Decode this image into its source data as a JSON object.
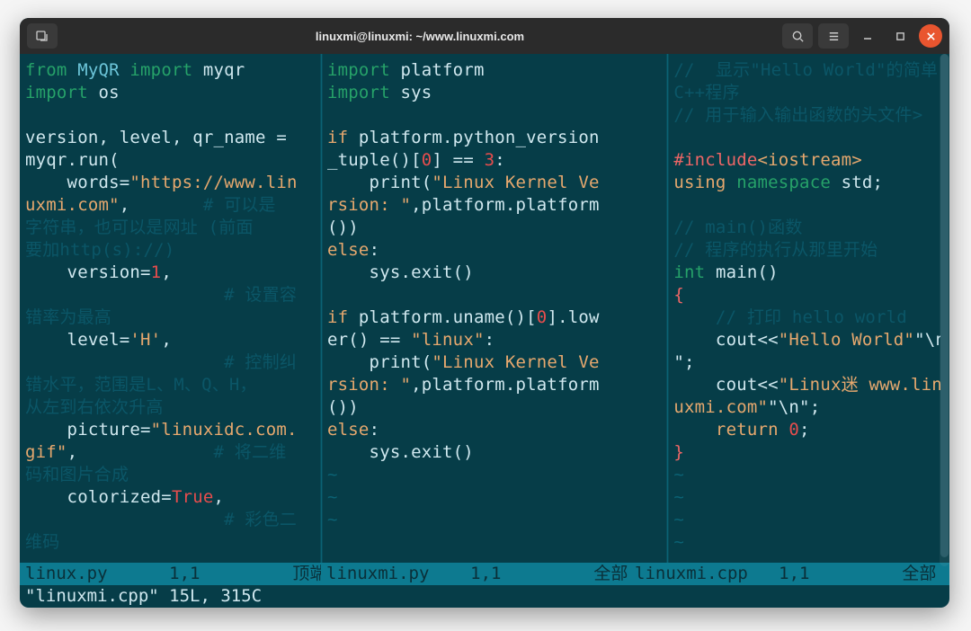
{
  "titlebar": {
    "title": "linuxmi@linuxmi: ~/www.linuxmi.com"
  },
  "cmdline": "\"linuxmi.cpp\" 15L, 315C",
  "status": {
    "p1": "linux.py      1,1         顶端",
    "p2": "linuxmi.py    1,1         全部",
    "p3": "linuxmi.cpp   1,1         全部"
  },
  "pane1": {
    "l01_from": "from",
    "l01_mod": "MyQR",
    "l01_import": "import",
    "l01_name": "myqr",
    "l02_import": "import",
    "l02_name": "os",
    "l04": "version, level, qr_name =",
    "l05": "myqr.run(",
    "l06_key": "    words=",
    "l06_str": "\"https://www.lin",
    "l07_str": "uxmi.com\"",
    "l07_comma": ",",
    "l07_cmt": "       # 可以是",
    "l08_cmt": "字符串，也可以是网址 (前面",
    "l09_cmt": "要加http(s)://)",
    "l10_key": "    version=",
    "l10_num": "1",
    "l10_comma": ",",
    "l11_cmt": "                   # 设置容",
    "l12_cmt": "错率为最高",
    "l13_key": "    level=",
    "l13_str": "'H'",
    "l13_comma": ",",
    "l14_cmt": "                   # 控制纠",
    "l15_cmt": "错水平，范围是L、M、Q、H，",
    "l16_cmt": "从左到右依次升高",
    "l17_key": "    picture=",
    "l17_str": "\"linuxidc.com.",
    "l18_str": "gif\"",
    "l18_comma": ",",
    "l18_cmt": "             # 将二维",
    "l19_cmt": "码和图片合成",
    "l20_key": "    colorized=",
    "l20_const": "True",
    "l20_comma": ",",
    "l21_cmt": "                   # 彩色二",
    "l22_cmt": "维码"
  },
  "pane2": {
    "l01_import": "import",
    "l01_name": "platform",
    "l02_import": "import",
    "l02_name": "sys",
    "l04_if": "if",
    "l04_rest": " platform.python_version",
    "l05a": "_tuple()[",
    "l05_num": "0",
    "l05b": "] == ",
    "l05_three": "3",
    "l05c": ":",
    "l06_print": "    print(",
    "l06_str": "\"Linux Kernel Ve",
    "l07_str": "rsion: \"",
    "l07_rest": ",platform.platform",
    "l08": "())",
    "l09_else": "else",
    "l09_colon": ":",
    "l10": "    sys.exit()",
    "l12_if": "if",
    "l12_rest": " platform.uname()[",
    "l12_num": "0",
    "l12_rest2": "].low",
    "l13a": "er() == ",
    "l13_str": "\"linux\"",
    "l13b": ":",
    "l14_print": "    print(",
    "l14_str": "\"Linux Kernel Ve",
    "l15_str": "rsion: \"",
    "l15_rest": ",platform.platform",
    "l16": "())",
    "l17_else": "else",
    "l17_colon": ":",
    "l18": "    sys.exit()",
    "tilde": "~"
  },
  "pane3": {
    "l01_cmt": "//  显示\"Hello World\"的简单",
    "l02_cmt": "C++程序",
    "l03_cmt": "// 用于输入输出函数的头文件>",
    "l04_cmt": " ",
    "l05_hash": "#include",
    "l05_hdr": "<iostream>",
    "l06_using": "using",
    "l06_ns": "namespace",
    "l06_std": "std;",
    "l08_cmt": "// main()函数",
    "l09_cmt": "// 程序的执行从那里开始",
    "l10_int": "int",
    "l10_main": "main()",
    "l11_brace": "{",
    "l12_cmt": "    // 打印 hello world",
    "l13a": "    cout<<",
    "l13_str": "\"Hello World\"",
    "l13b": "\"\\n",
    "l14a": "\";",
    "l15a": "    cout<<",
    "l15_str": "\"Linux迷 www.lin",
    "l16_str": "uxmi.com\"",
    "l16b": "\"\\n\";",
    "l17_ret": "    return",
    "l17_num": " 0",
    "l17_semi": ";",
    "l18_brace": "}",
    "tilde": "~"
  }
}
